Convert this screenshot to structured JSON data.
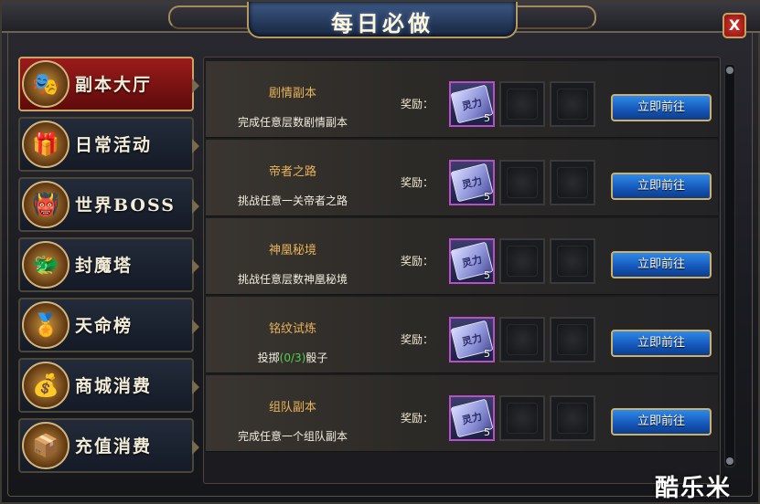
{
  "window": {
    "title": "每日必做",
    "close_label": "X"
  },
  "sidebar": {
    "items": [
      {
        "label": "副本大厅",
        "icon": "🎭",
        "icon_name": "dungeon-mask-icon",
        "active": true
      },
      {
        "label": "日常活动",
        "icon": "🎁",
        "icon_name": "daily-gift-icon",
        "active": false
      },
      {
        "label": "世界BOSS",
        "icon": "👹",
        "icon_name": "boss-demon-icon",
        "active": false
      },
      {
        "label": "封魔塔",
        "icon": "🐲",
        "icon_name": "demon-tower-icon",
        "active": false
      },
      {
        "label": "天命榜",
        "icon": "🏅",
        "icon_name": "destiny-rank-icon",
        "active": false
      },
      {
        "label": "商城消费",
        "icon": "💰",
        "icon_name": "mall-treasure-icon",
        "active": false
      },
      {
        "label": "充值消费",
        "icon": "📦",
        "icon_name": "recharge-chest-icon",
        "active": false
      }
    ]
  },
  "tasks": [
    {
      "name": "剧情副本",
      "desc": "完成任意层数剧情副本",
      "reward_label": "奖励：",
      "reward_item": "灵力",
      "reward_qty": "5",
      "button": "立即前往"
    },
    {
      "name": "帝者之路",
      "desc": "挑战任意一关帝者之路",
      "reward_label": "奖励：",
      "reward_item": "灵力",
      "reward_qty": "5",
      "button": "立即前往"
    },
    {
      "name": "神凰秘境",
      "desc": "挑战任意层数神凰秘境",
      "reward_label": "奖励：",
      "reward_item": "灵力",
      "reward_qty": "5",
      "button": "立即前往"
    },
    {
      "name": "铭纹试炼",
      "desc_prefix": "投掷",
      "desc_progress": "(0/3)",
      "desc_suffix": "骰子",
      "reward_label": "奖励：",
      "reward_item": "灵力",
      "reward_qty": "5",
      "button": "立即前往"
    },
    {
      "name": "组队副本",
      "desc": "完成任意一个组队副本",
      "reward_label": "奖励：",
      "reward_item": "灵力",
      "reward_qty": "5",
      "button": "立即前往"
    }
  ],
  "watermark": "酷乐米",
  "colors": {
    "accent_gold": "#cdb06c",
    "task_title": "#e8b35a",
    "progress_green": "#52d14a",
    "button_blue": "#1456b8",
    "active_tab_red": "#9b1b1b"
  }
}
